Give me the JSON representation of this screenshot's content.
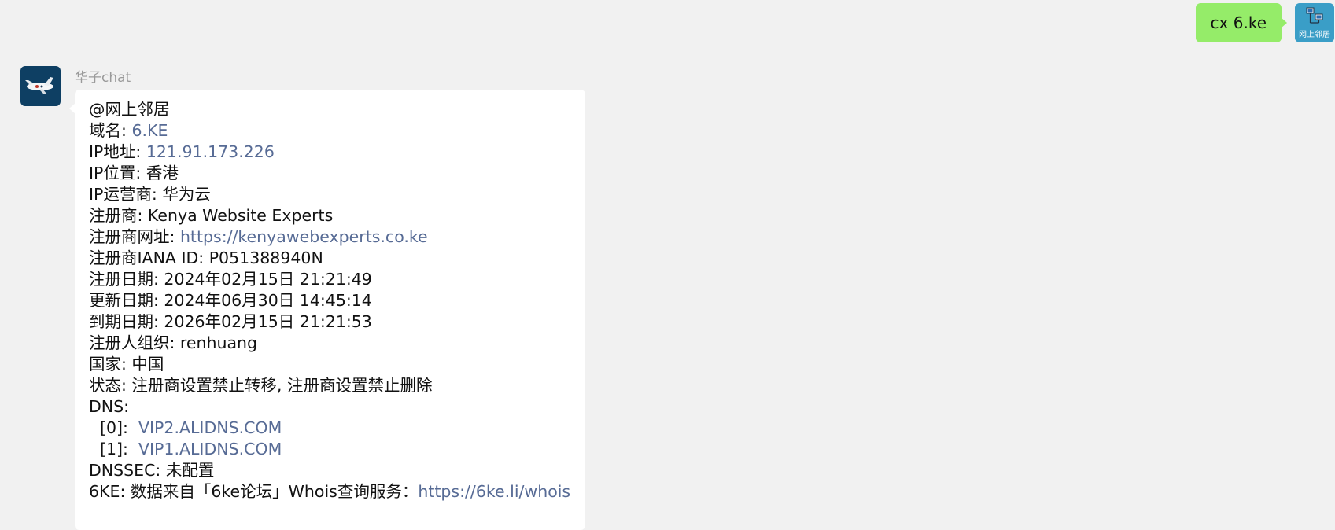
{
  "user": {
    "avatar_caption": "网上邻居",
    "message": "cx 6.ke"
  },
  "bot": {
    "name": "华子chat",
    "lines": {
      "mention": "@网上邻居",
      "domain_label": "域名: ",
      "domain_value": "6.KE",
      "ip_label": "IP地址: ",
      "ip_value": "121.91.173.226",
      "location": "IP位置: 香港",
      "isp": "IP运营商: 华为云",
      "registrar": "注册商: Kenya Website Experts",
      "registrar_url_label": "注册商网址: ",
      "registrar_url": "https://kenyawebexperts.co.ke",
      "iana_id": "注册商IANA ID: P051388940N",
      "created": "注册日期: 2024年02月15日 21:21:49",
      "updated": "更新日期: 2024年06月30日 14:45:14",
      "expires": "到期日期: 2026年02月15日 21:21:53",
      "org": "注册人组织: renhuang",
      "country": "国家: 中国",
      "status": "状态: 注册商设置禁止转移, 注册商设置禁止删除",
      "dns_label": "DNS:",
      "dns0_label": "[0]:  ",
      "dns0_value": "VIP2.ALIDNS.COM",
      "dns1_label": "[1]:  ",
      "dns1_value": "VIP1.ALIDNS.COM",
      "dnssec": "DNSSEC: 未配置",
      "source_label": "6KE: 数据来自「6ke论坛」Whois查询服务：",
      "source_url": "https://6ke.li/whois"
    }
  },
  "colors": {
    "background": "#f1f1f1",
    "outgoing_bubble": "#95ec69",
    "incoming_bubble": "#ffffff",
    "link": "#576b95"
  }
}
